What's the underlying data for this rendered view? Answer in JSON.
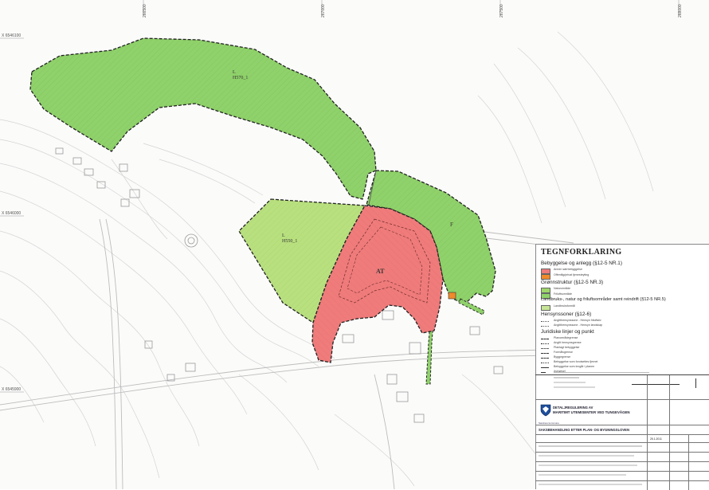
{
  "map": {
    "coords_top": [
      "266500",
      "267000",
      "267500",
      "268000"
    ],
    "coords_left": [
      "X 6546100",
      "X 6546000",
      "X 6545900"
    ],
    "zones": [
      {
        "id": "north",
        "label_top": "L",
        "label_bottom": "H570_1",
        "color": "#8fd16a"
      },
      {
        "id": "west",
        "label_top": "L",
        "label_bottom": "H550_1",
        "color": "#b9e07f"
      },
      {
        "id": "center",
        "label": "AT",
        "color": "#ef7b7b"
      },
      {
        "id": "east",
        "label": "F",
        "color": "#8fd16a"
      }
    ]
  },
  "legend": {
    "title": "TEGNFORKLARING",
    "sections": [
      {
        "heading": "Bebyggelse og anlegg (§12-5 NR.1)",
        "items": [
          {
            "label": "Annen særbebyggelse",
            "color": "#ef7b7b"
          },
          {
            "label": "Offentlig/privat tjenesteyting",
            "color": "#f08a2a"
          }
        ]
      },
      {
        "heading": "Grønnstruktur (§12-5 NR.3)",
        "items": [
          {
            "label": "Naturområde",
            "color": "#9ed66b"
          },
          {
            "label": "Friluftsområde",
            "color": "#8fd16a"
          }
        ]
      },
      {
        "heading": "Landbruks-, natur og friluftsområder samt reindrift (§12-5 NR.5)",
        "items": [
          {
            "label": "Landbruksformål",
            "color": "#c6e596"
          }
        ]
      },
      {
        "heading": "Hensynssoner (§12-6)",
        "items": [
          {
            "label": "Angitthensynssone - Hensyn friluftsliv"
          },
          {
            "label": "Angitthensynssone - Hensyn landskap"
          }
        ]
      },
      {
        "heading": "Juridiske linjer og punkt",
        "items": [
          {
            "label": "Planområdegrense"
          },
          {
            "label": "Angitt hensynsgrense"
          },
          {
            "label": "Planlagt bebyggelse"
          },
          {
            "label": "Formålsgrense"
          },
          {
            "label": "Byggegrense"
          },
          {
            "label": "Bebyggelse som forutsettes fjernet"
          },
          {
            "label": "Bebyggelse som inngår i planen"
          },
          {
            "label": "Avkjørsel"
          }
        ]
      }
    ]
  },
  "titleblock": {
    "org": "DETALJREGULERING AV",
    "project": "MARITIMT UTEMISENTER VED TUNGEVÅGEN",
    "municipality": "Sandnes kommune",
    "sak": "SAKSBEHANDLING ETTER PLAN- OG BYGNINGSLOVEN",
    "date": "25.1.2011"
  }
}
